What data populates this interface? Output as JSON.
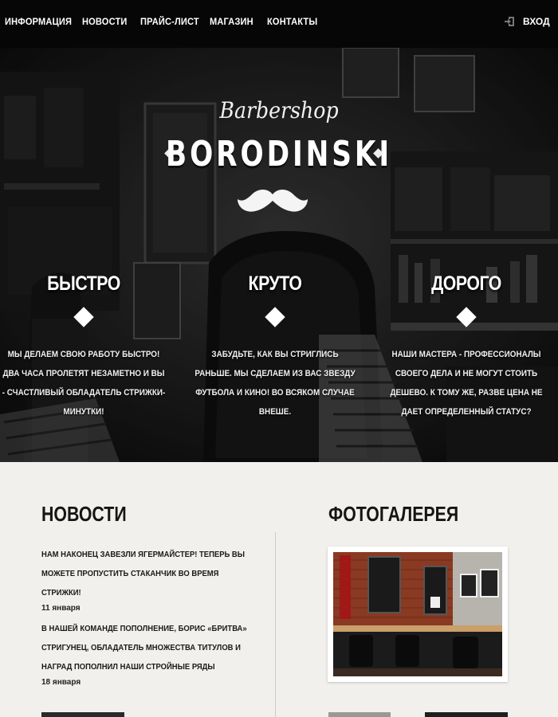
{
  "nav": {
    "items": [
      "ИНФОРМАЦИЯ",
      "НОВОСТИ",
      "ПРАЙС-ЛИСТ",
      "МАГАЗИН",
      "КОНТАКТЫ"
    ],
    "login_label": "ВХОД"
  },
  "hero": {
    "script_title": "Barbershop",
    "brand": "BORODINSKI",
    "features": [
      {
        "title": "БЫСТРО",
        "text": "МЫ ДЕЛАЕМ СВОЮ РАБОТУ БЫСТРО! ДВА ЧАСА ПРОЛЕТЯТ НЕЗАМЕТНО И ВЫ - СЧАСТЛИВЫЙ ОБЛАДАТЕЛЬ СТРИЖКИ-МИНУТКИ!"
      },
      {
        "title": "КРУТО",
        "text": "ЗАБУДЬТЕ, КАК ВЫ СТРИГЛИСЬ РАНЬШЕ. МЫ СДЕЛАЕМ ИЗ ВАС ЗВЕЗДУ ФУТБОЛА И КИНО! ВО ВСЯКОМ СЛУЧАЕ ВНЕШЕ."
      },
      {
        "title": "ДОРОГО",
        "text": "НАШИ МАСТЕРА - ПРОФЕССИОНАЛЫ СВОЕГО ДЕЛА И НЕ МОГУТ СТОИТЬ ДЕШЕВО. К ТОМУ ЖЕ, РАЗВЕ ЦЕНА НЕ ДАЕТ ОПРЕДЕЛЕННЫЙ СТАТУС?"
      }
    ]
  },
  "news": {
    "title": "НОВОСТИ",
    "items": [
      {
        "text": "НАМ НАКОНЕЦ ЗАВЕЗЛИ ЯГЕРМАЙСТЕР! ТЕПЕРЬ ВЫ МОЖЕТЕ ПРОПУСТИТЬ СТАКАНЧИК ВО ВРЕМЯ СТРИЖКИ!",
        "date": "11 января"
      },
      {
        "text": "В НАШЕЙ КОМАНДЕ ПОПОЛНЕНИЕ, БОРИС «БРИТВА» СТРИГУНЕЦ, ОБЛАДАТЕЛЬ МНОЖЕСТВА ТИТУЛОВ И НАГРАД ПОПОЛНИЛ НАШИ СТРОЙНЫЕ РЯДЫ",
        "date": "18 января"
      }
    ]
  },
  "gallery": {
    "title": "ФОТОГАЛЕРЕЯ"
  },
  "icons": {
    "login": "login-icon",
    "mustache": "mustache-icon",
    "diamond": "diamond-icon"
  },
  "colors": {
    "nav_bg": "#060606",
    "hero_overlay": "#1b1b1b",
    "content_bg": "#f2f0ed",
    "accent_brick": "#8a3a22"
  }
}
